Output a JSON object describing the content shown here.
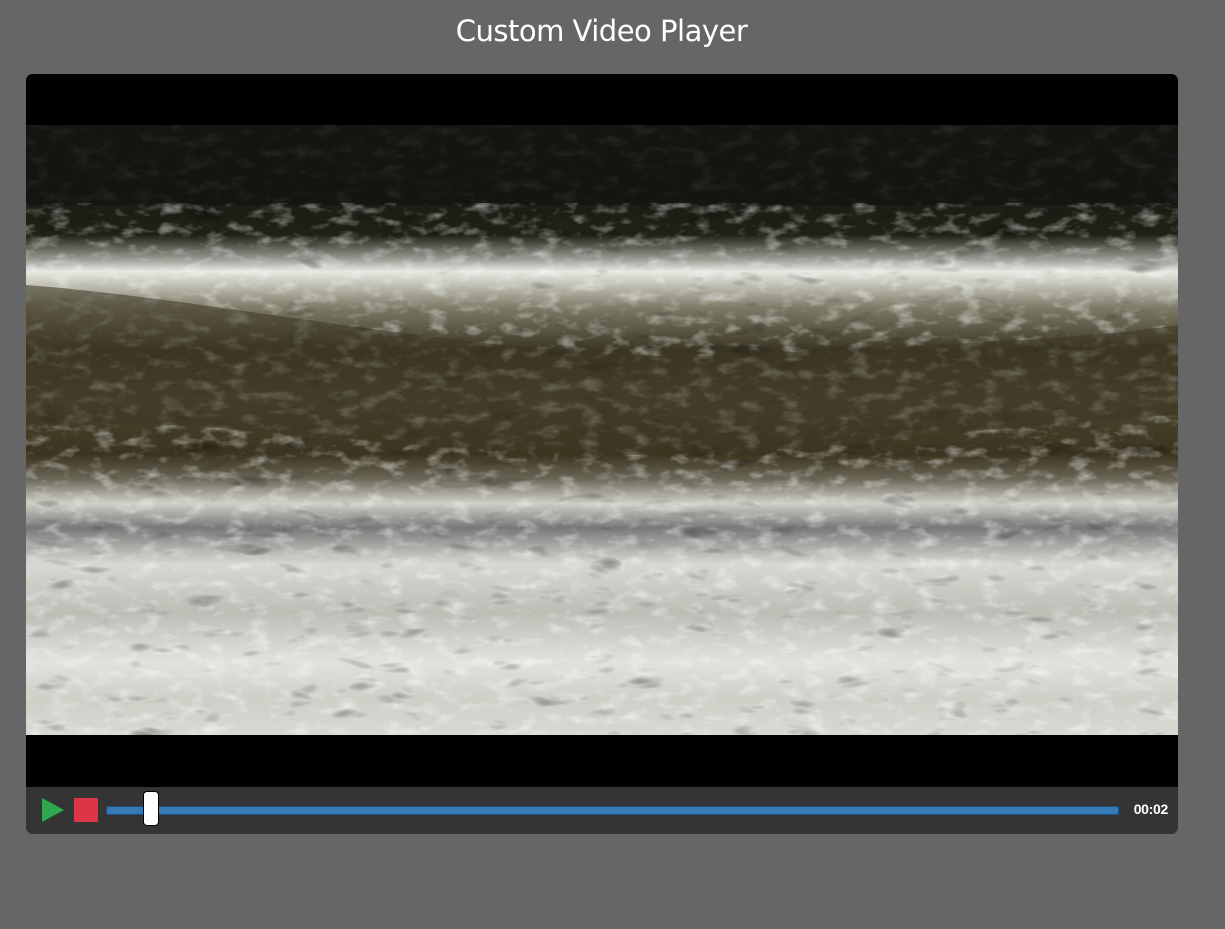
{
  "page": {
    "title": "Custom Video Player"
  },
  "player": {
    "controls": {
      "play_icon": "play-icon",
      "stop_icon": "stop-icon",
      "play_color": "#2fa84f",
      "stop_color": "#dc3545",
      "track_color": "#337ab7",
      "progress_fraction": 0.044,
      "time": "00:02"
    }
  }
}
